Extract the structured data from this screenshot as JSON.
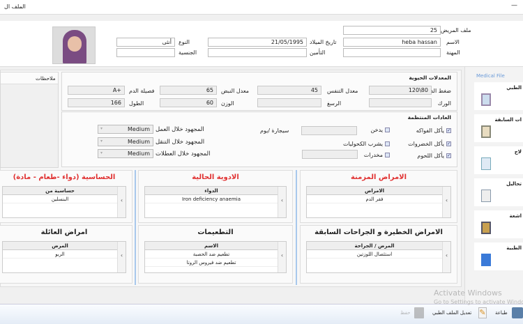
{
  "window": {
    "title": "الملف ال",
    "minimize": "—"
  },
  "patient": {
    "file_label": "ملف المريض",
    "file_value": "25",
    "name_label": "الاسم",
    "name_value": "heba hassan",
    "job_label": "المهنة",
    "job_value": "",
    "dob_label": "تاريخ الميلاد",
    "dob_value": "21/05/1995",
    "insurance_label": "التأمين",
    "insurance_value": "",
    "gender_label": "النوع",
    "gender_value": "أنثى",
    "nationality_label": "الجنسية",
    "nationality_value": ""
  },
  "notes": {
    "title": "ملاحظات"
  },
  "vitals": {
    "title": "المعدلات الحيوية",
    "bp_label": "ضغط الدم",
    "bp_value": "120\\80",
    "resp_label": "معدل التنفس",
    "resp_value": "45",
    "pulse_label": "معدل النبض",
    "pulse_value": "65",
    "blood_label": "فصيلة الدم",
    "blood_value": "A+",
    "hip_label": "الورك",
    "hip_value": "",
    "wrist_label": "الرسغ",
    "wrist_value": "",
    "weight_label": "الوزن",
    "weight_value": "60",
    "height_label": "الطول",
    "height_value": "166"
  },
  "habits": {
    "title": "العادات المنتظمة",
    "fruit": "يأكل الفواكه",
    "veg": "يأكل الخضروات",
    "meat": "يأكل اللحوم",
    "smoke": "يدخن",
    "alcohol": "يشرب الكحوليات",
    "drugs": "مخدرات",
    "cig_unit": "سيجارة /يوم",
    "work_label": "المجهود خلال العمل",
    "work_value": "Medium",
    "commute_label": "المجهود خلال التنقل",
    "commute_value": "Medium",
    "holiday_label": "المجهود خلال العطلات",
    "holiday_value": "Medium"
  },
  "groups": [
    {
      "title": "الامراض المزمنة",
      "header": "الامراض",
      "rows": [
        "فقر الدم"
      ]
    },
    {
      "title": "الادوية الحالية",
      "header": "الدواء",
      "rows": [
        "Iron deficiency anaemia"
      ]
    },
    {
      "title": "الحساسية (دواء -طعام - مادة)",
      "header": "حساسية من",
      "rows": [
        "البنسلين"
      ]
    },
    {
      "title": "الامراض الخطيرة و الجراحات السابقة",
      "header": "المرض / الجراحة",
      "rows": [
        "استئصال اللوزتين"
      ]
    },
    {
      "title": "التطعيمات",
      "header": "الاسم",
      "rows": [
        "تطعيم ضد الحصبة",
        "تطعيم ضد فيروس الروتا"
      ]
    },
    {
      "title": "امراض العائلة",
      "header": "المرض",
      "rows": [
        "الربو"
      ]
    }
  ],
  "sidebar": {
    "title": "Medical File",
    "items": [
      "الطبي",
      "ات السابقة",
      "لاج",
      "تحاليل",
      "اشعة",
      "الطبية"
    ]
  },
  "toolbar": {
    "print": "طباعة",
    "edit": "تعديل الملف الطبي",
    "save": "حفظ"
  },
  "watermark": {
    "line1": "Activate Windows",
    "line2": "Go to Settings to activate Windows."
  },
  "colors": {
    "accent": "#e03030",
    "sidebar_title": "#6a9ad8"
  }
}
